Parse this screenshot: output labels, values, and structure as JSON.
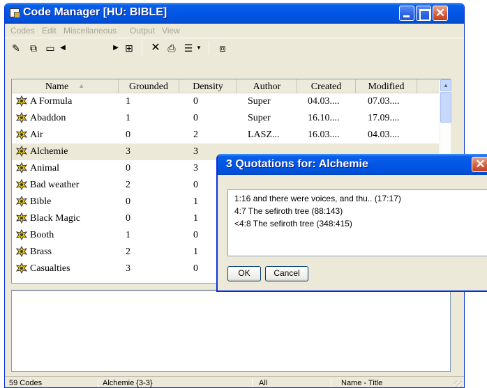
{
  "window": {
    "title": "Code Manager [HU: BIBLE]"
  },
  "menu": [
    "Codes",
    "Edit",
    "Miscellaneous",
    "Output",
    "View"
  ],
  "toolbar_icons": [
    "new-code-icon",
    "merge-icon",
    "window-icon",
    "arrow-left-icon",
    "arrow-right-icon",
    "network-icon",
    "delete-icon",
    "print-icon",
    "list-view-icon",
    "dropdown-icon",
    "export-icon"
  ],
  "list": {
    "columns": [
      "Name",
      "Grounded",
      "Density",
      "Author",
      "Created",
      "Modified"
    ],
    "rows": [
      {
        "name": "A Formula",
        "grounded": "1",
        "density": "0",
        "author": "Super",
        "created": "04.03....",
        "modified": "07.03...."
      },
      {
        "name": "Abaddon",
        "grounded": "1",
        "density": "0",
        "author": "Super",
        "created": "16.10....",
        "modified": "17.09...."
      },
      {
        "name": "Air",
        "grounded": "0",
        "density": "2",
        "author": "LASZ...",
        "created": "16.03....",
        "modified": "04.03...."
      },
      {
        "name": "Alchemie",
        "grounded": "3",
        "density": "3",
        "author": "",
        "created": "",
        "modified": ""
      },
      {
        "name": "Animal",
        "grounded": "0",
        "density": "3",
        "author": "",
        "created": "",
        "modified": ""
      },
      {
        "name": "Bad weather",
        "grounded": "2",
        "density": "0",
        "author": "",
        "created": "",
        "modified": ""
      },
      {
        "name": "Bible",
        "grounded": "0",
        "density": "1",
        "author": "",
        "created": "",
        "modified": ""
      },
      {
        "name": "Black Magic",
        "grounded": "0",
        "density": "1",
        "author": "",
        "created": "",
        "modified": ""
      },
      {
        "name": "Booth",
        "grounded": "1",
        "density": "0",
        "author": "",
        "created": "",
        "modified": ""
      },
      {
        "name": "Brass",
        "grounded": "2",
        "density": "1",
        "author": "",
        "created": "",
        "modified": ""
      },
      {
        "name": "Casualties",
        "grounded": "3",
        "density": "0",
        "author": "",
        "created": "",
        "modified": ""
      }
    ],
    "selected_row": "Alchemie"
  },
  "status": {
    "count": "59 Codes",
    "selection": "Alchemie {3-3}",
    "filter": "All",
    "sort": "Name - Title"
  },
  "popup": {
    "title": "3 Quotations for: Alchemie",
    "quotes": [
      "1:16 and there were voices, and thu.. (17:17)",
      "4:7 The sefiroth tree (88:143)",
      "<4:8 The sefiroth tree (348:415)"
    ],
    "ok_label": "OK",
    "cancel_label": "Cancel"
  },
  "colors": {
    "titlebar": "#0256e6",
    "window_bg": "#ece9d8",
    "close_button": "#d65a3c",
    "code_icon": "#f5d000"
  }
}
